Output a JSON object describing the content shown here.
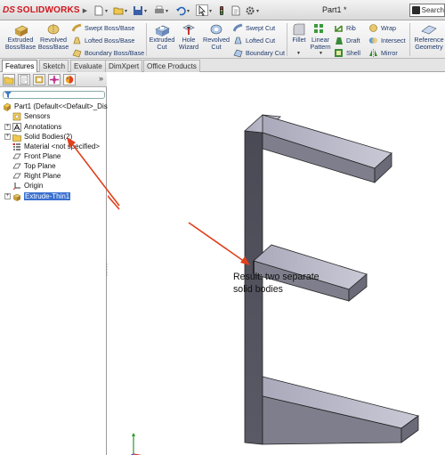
{
  "app": {
    "brand_prefix": "DS",
    "brand": "SOLIDWORKS",
    "document_title": "Part1 *"
  },
  "search": {
    "placeholder": "Search"
  },
  "ribbon": {
    "extruded_boss": "Extruded\nBoss/Base",
    "revolved_boss": "Revolved\nBoss/Base",
    "swept_boss": "Swept Boss/Base",
    "lofted_boss": "Lofted Boss/Base",
    "boundary_boss": "Boundary Boss/Base",
    "extruded_cut": "Extruded\nCut",
    "hole_wizard": "Hole\nWizard",
    "revolved_cut": "Revolved\nCut",
    "swept_cut": "Swept Cut",
    "lofted_cut": "Lofted Cut",
    "boundary_cut": "Boundary Cut",
    "fillet": "Fillet",
    "linear_pattern": "Linear\nPattern",
    "rib": "Rib",
    "draft": "Draft",
    "shell": "Shell",
    "wrap": "Wrap",
    "intersect": "Intersect",
    "mirror": "Mirror",
    "reference_geometry": "Reference\nGeometry"
  },
  "tabs": [
    "Features",
    "Sketch",
    "Evaluate",
    "DimXpert",
    "Office Products"
  ],
  "tree": {
    "root": "Part1  (Default<<Default>_Disp",
    "items": [
      "Sensors",
      "Annotations",
      "Solid Bodies(2)",
      "Material <not specified>",
      "Front Plane",
      "Top Plane",
      "Right Plane",
      "Origin",
      "Extrude-Thin1"
    ]
  },
  "annotation": {
    "line1": "Result: two separate",
    "line2": "solid bodies"
  },
  "colors": {
    "brand": "#d2161d",
    "arrow": "#e0401c",
    "selection": "#3a6fd0",
    "model_front": "#55555f",
    "model_top": "#b8b8c8",
    "model_side": "#7e7e8c"
  },
  "icons": [
    "solidworks-logo",
    "new-icon",
    "open-icon",
    "save-icon",
    "print-icon",
    "undo-icon",
    "select-icon",
    "rebuild-icon",
    "options-icon",
    "search-icon"
  ]
}
